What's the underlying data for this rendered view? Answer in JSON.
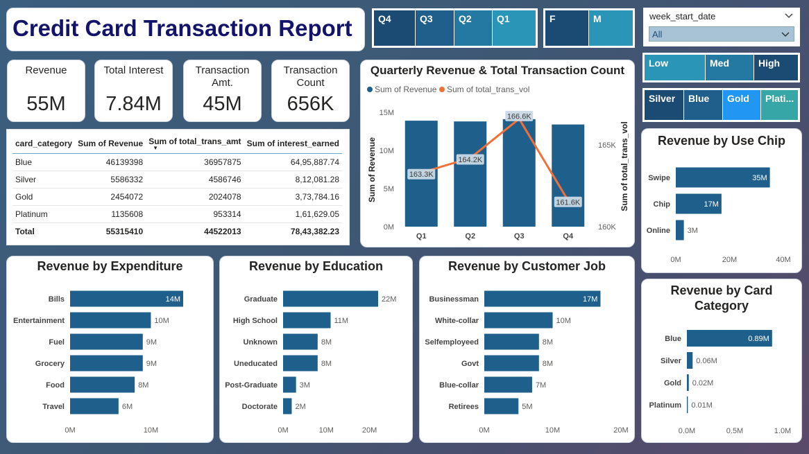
{
  "report_title": "Credit Card Transaction Report",
  "slicers": {
    "quarters": [
      "Q4",
      "Q3",
      "Q2",
      "Q1"
    ],
    "gender": [
      "F",
      "M"
    ],
    "week": {
      "label": "week_start_date",
      "value": "All"
    },
    "income": [
      "Low",
      "Med",
      "High"
    ],
    "card": [
      "Silver",
      "Blue",
      "Gold",
      "Plati..."
    ]
  },
  "kpis": [
    {
      "label": "Revenue",
      "value": "55M"
    },
    {
      "label": "Total Interest",
      "value": "7.84M"
    },
    {
      "label": "Transaction Amt.",
      "value": "45M"
    },
    {
      "label": "Transaction Count",
      "value": "656K"
    }
  ],
  "table": {
    "headers": [
      "card_category",
      "Sum of Revenue",
      "Sum of total_trans_amt",
      "Sum of interest_earned"
    ],
    "rows": [
      [
        "Blue",
        "46139398",
        "36957875",
        "64,95,887.74"
      ],
      [
        "Silver",
        "5586332",
        "4586746",
        "8,12,081.28"
      ],
      [
        "Gold",
        "2454072",
        "2024078",
        "3,73,784.16"
      ],
      [
        "Platinum",
        "1135608",
        "953314",
        "1,61,629.05"
      ]
    ],
    "total": [
      "Total",
      "55315410",
      "44522013",
      "78,43,382.23"
    ]
  },
  "chart_data": [
    {
      "id": "quarterly",
      "type": "bar",
      "title": "Quarterly Revenue & Total Transaction Count",
      "legend": [
        "Sum of Revenue",
        "Sum of total_trans_vol"
      ],
      "categories": [
        "Q1",
        "Q2",
        "Q3",
        "Q4"
      ],
      "series": [
        {
          "name": "Sum of Revenue",
          "values": [
            13.9,
            13.8,
            14.1,
            13.4
          ]
        },
        {
          "name": "Sum of total_trans_vol",
          "values": [
            163.3,
            164.2,
            166.6,
            161.6
          ],
          "labels": [
            "163.3K",
            "164.2K",
            "166.6K",
            "161.6K"
          ]
        }
      ],
      "ylabel": "Sum of Revenue",
      "y2label": "Sum of total_trans_vol",
      "yticks": [
        "0M",
        "5M",
        "10M",
        "15M"
      ],
      "y2ticks": [
        "160K",
        "165K"
      ],
      "ylim": [
        0,
        15
      ],
      "y2lim": [
        160,
        167
      ]
    },
    {
      "id": "usechip",
      "type": "bar",
      "title": "Revenue by Use Chip",
      "categories": [
        "Swipe",
        "Chip",
        "Online"
      ],
      "values": [
        35,
        17,
        3
      ],
      "labels": [
        "35M",
        "17M",
        "3M"
      ],
      "xticks": [
        "0M",
        "20M",
        "40M"
      ],
      "xlim": [
        0,
        40
      ]
    },
    {
      "id": "expenditure",
      "type": "bar",
      "title": "Revenue by Expenditure",
      "categories": [
        "Bills",
        "Entertainment",
        "Fuel",
        "Grocery",
        "Food",
        "Travel"
      ],
      "values": [
        14,
        10,
        9,
        9,
        8,
        6
      ],
      "labels": [
        "14M",
        "10M",
        "9M",
        "9M",
        "8M",
        "6M"
      ],
      "xticks": [
        "0M",
        "10M"
      ],
      "xlim": [
        0,
        14
      ]
    },
    {
      "id": "education",
      "type": "bar",
      "title": "Revenue by Education",
      "categories": [
        "Graduate",
        "High School",
        "Unknown",
        "Uneducated",
        "Post-Graduate",
        "Doctorate"
      ],
      "values": [
        22,
        11,
        8,
        8,
        3,
        2
      ],
      "labels": [
        "22M",
        "11M",
        "8M",
        "8M",
        "3M",
        "2M"
      ],
      "xticks": [
        "0M",
        "10M",
        "20M"
      ],
      "xlim": [
        0,
        22
      ]
    },
    {
      "id": "job",
      "type": "bar",
      "title": "Revenue by Customer Job",
      "categories": [
        "Businessman",
        "White-collar",
        "Selfemployeed",
        "Govt",
        "Blue-collar",
        "Retirees"
      ],
      "values": [
        17,
        10,
        8,
        8,
        7,
        5
      ],
      "labels": [
        "17M",
        "10M",
        "8M",
        "8M",
        "7M",
        "5M"
      ],
      "xticks": [
        "0M",
        "10M",
        "20M"
      ],
      "xlim": [
        0,
        20
      ]
    },
    {
      "id": "cardcat",
      "type": "bar",
      "title": "Revenue by Card Category",
      "categories": [
        "Blue",
        "Silver",
        "Gold",
        "Platinum"
      ],
      "values": [
        0.89,
        0.06,
        0.02,
        0.01
      ],
      "labels": [
        "0.89M",
        "0.06M",
        "0.02M",
        "0.01M"
      ],
      "xticks": [
        "0.0M",
        "0.5M",
        "1.0M"
      ],
      "xlim": [
        0,
        1.0
      ]
    }
  ],
  "colors": {
    "bar": "#1f5f8b",
    "line": "#f07138",
    "title_blue": "#13136b",
    "q4": "#1b4a72",
    "q3": "#205e8c",
    "q2": "#2479a3",
    "q1": "#2b95b8",
    "f": "#1b4a72",
    "m": "#2b95b8",
    "low": "#2b95b8",
    "med": "#2479a3",
    "high": "#1b4a72",
    "silver": "#1b4a72",
    "blue": "#205e8c",
    "gold": "#2196f3",
    "plat": "#36a6a6"
  }
}
